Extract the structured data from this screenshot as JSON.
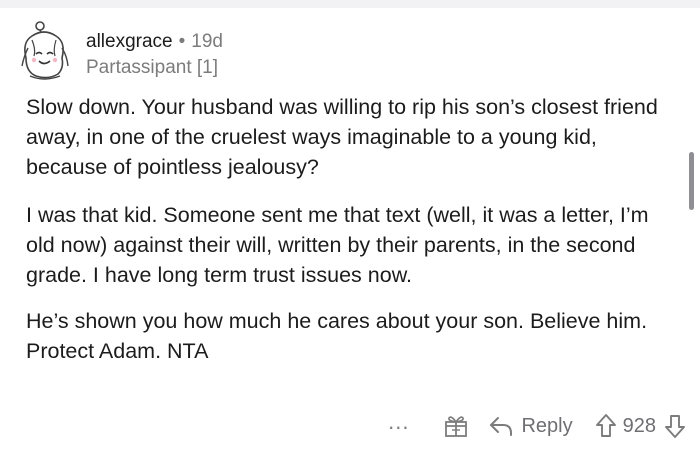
{
  "comment": {
    "author": "allexgrace",
    "separator": "•",
    "age": "19d",
    "flair": "Partassipant [1]",
    "paragraphs": [
      "Slow down. Your husband was willing to rip his son’s closest friend away, in one of the cruelest ways imaginable to a young kid, because of pointless jealousy?",
      "I was that kid. Someone sent me that text (well, it was a letter, I’m old now) against their will, written by their parents, in the second grade. I have long term trust issues now.",
      "He’s shown you how much he cares about your son. Believe him. Protect Adam. NTA"
    ]
  },
  "actions": {
    "more_label": "...",
    "award_icon": "gift-icon",
    "reply_icon": "reply-arrow-icon",
    "reply_label": "Reply",
    "upvote_icon": "upvote-arrow-icon",
    "score": "928",
    "downvote_icon": "downvote-arrow-icon"
  }
}
